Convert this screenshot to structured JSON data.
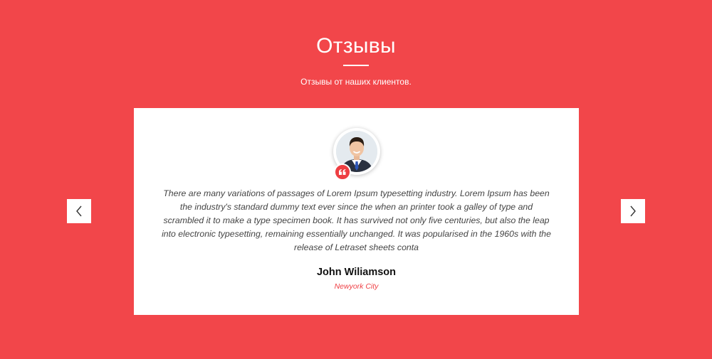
{
  "section": {
    "title": "Отзывы",
    "subtitle": "Отзывы от наших клиентов."
  },
  "testimonial": {
    "text": "There are many variations of passages of Lorem Ipsum typesetting industry. Lorem Ipsum has been the industry's standard dummy text ever since the when an printer took a galley of type and scrambled it to make a type specimen book. It has survived not only five centuries, but also the leap into electronic typesetting, remaining essentially unchanged. It was popularised in the 1960s with the release of Letraset sheets conta",
    "author": "John Wiliamson",
    "city": "Newyork City"
  },
  "carousel": {
    "prev_icon": "chevron-left-icon",
    "next_icon": "chevron-right-icon"
  },
  "colors": {
    "background": "#f2464a",
    "card": "#ffffff",
    "accent": "#ee3e42"
  }
}
